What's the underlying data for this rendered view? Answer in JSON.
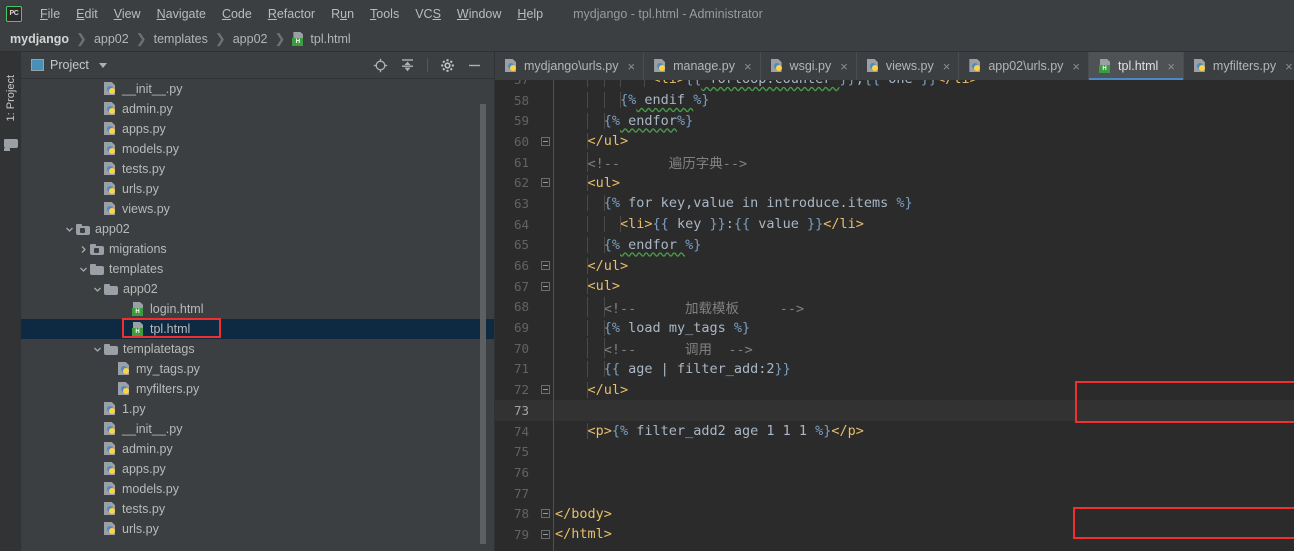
{
  "window": {
    "title": "mydjango - tpl.html - Administrator",
    "logo_text": "PC"
  },
  "menu": {
    "items": [
      {
        "label": "File",
        "mnemonic": "F"
      },
      {
        "label": "Edit",
        "mnemonic": "E"
      },
      {
        "label": "View",
        "mnemonic": "V"
      },
      {
        "label": "Navigate",
        "mnemonic": "N"
      },
      {
        "label": "Code",
        "mnemonic": "C"
      },
      {
        "label": "Refactor",
        "mnemonic": "R"
      },
      {
        "label": "Run",
        "mnemonic": "u"
      },
      {
        "label": "Tools",
        "mnemonic": "T"
      },
      {
        "label": "VCS",
        "mnemonic": "S"
      },
      {
        "label": "Window",
        "mnemonic": "W"
      },
      {
        "label": "Help",
        "mnemonic": "H"
      }
    ]
  },
  "breadcrumb": {
    "items": [
      "mydjango",
      "app02",
      "templates",
      "app02"
    ],
    "file": "tpl.html",
    "file_icon": "html-file-icon",
    "separator": "❯"
  },
  "toolstrip": {
    "tab_label": "1: Project",
    "folder_icon": "folder-icon"
  },
  "project_panel": {
    "title": "Project",
    "title_icon": "project-window-icon",
    "dropdown_icon": "chevron-down-icon",
    "actions": [
      {
        "name": "scroll-from-source-icon",
        "label": "Select Opened File"
      },
      {
        "name": "collapse-all-icon",
        "label": "Collapse All"
      },
      {
        "name": "gear-icon",
        "label": "Settings"
      },
      {
        "name": "minimize-icon",
        "label": "Hide"
      }
    ],
    "tree": [
      {
        "label": "__init__.py",
        "icon": "python-file-icon",
        "indent": 5,
        "twist": "",
        "selected": false
      },
      {
        "label": "admin.py",
        "icon": "python-file-icon",
        "indent": 5,
        "twist": "",
        "selected": false
      },
      {
        "label": "apps.py",
        "icon": "python-file-icon",
        "indent": 5,
        "twist": "",
        "selected": false
      },
      {
        "label": "models.py",
        "icon": "python-file-icon",
        "indent": 5,
        "twist": "",
        "selected": false
      },
      {
        "label": "tests.py",
        "icon": "python-file-icon",
        "indent": 5,
        "twist": "",
        "selected": false
      },
      {
        "label": "urls.py",
        "icon": "python-file-icon",
        "indent": 5,
        "twist": "",
        "selected": false
      },
      {
        "label": "views.py",
        "icon": "python-file-icon",
        "indent": 5,
        "twist": "",
        "selected": false
      },
      {
        "label": "app02",
        "icon": "source-folder-icon",
        "indent": 3,
        "twist": "down",
        "selected": false
      },
      {
        "label": "migrations",
        "icon": "source-folder-icon",
        "indent": 4,
        "twist": "right",
        "selected": false
      },
      {
        "label": "templates",
        "icon": "folder-icon",
        "indent": 4,
        "twist": "down",
        "selected": false
      },
      {
        "label": "app02",
        "icon": "folder-icon",
        "indent": 5,
        "twist": "down",
        "selected": false
      },
      {
        "label": "login.html",
        "icon": "html-file-icon",
        "indent": 7,
        "twist": "",
        "selected": false
      },
      {
        "label": "tpl.html",
        "icon": "html-file-icon",
        "indent": 7,
        "twist": "",
        "selected": true
      },
      {
        "label": "templatetags",
        "icon": "folder-icon",
        "indent": 5,
        "twist": "down",
        "selected": false
      },
      {
        "label": "my_tags.py",
        "icon": "python-file-icon",
        "indent": 6,
        "twist": "",
        "selected": false
      },
      {
        "label": "myfilters.py",
        "icon": "python-file-icon",
        "indent": 6,
        "twist": "",
        "selected": false
      },
      {
        "label": "1.py",
        "icon": "python-file-icon",
        "indent": 5,
        "twist": "",
        "selected": false
      },
      {
        "label": "__init__.py",
        "icon": "python-file-icon",
        "indent": 5,
        "twist": "",
        "selected": false
      },
      {
        "label": "admin.py",
        "icon": "python-file-icon",
        "indent": 5,
        "twist": "",
        "selected": false
      },
      {
        "label": "apps.py",
        "icon": "python-file-icon",
        "indent": 5,
        "twist": "",
        "selected": false
      },
      {
        "label": "models.py",
        "icon": "python-file-icon",
        "indent": 5,
        "twist": "",
        "selected": false
      },
      {
        "label": "tests.py",
        "icon": "python-file-icon",
        "indent": 5,
        "twist": "",
        "selected": false
      },
      {
        "label": "urls.py",
        "icon": "python-file-icon",
        "indent": 5,
        "twist": "",
        "selected": false
      }
    ]
  },
  "editor": {
    "tabs": [
      {
        "label": "mydjango\\urls.py",
        "icon": "python-file-icon",
        "active": false,
        "close": "×"
      },
      {
        "label": "manage.py",
        "icon": "python-file-icon",
        "active": false,
        "close": "×"
      },
      {
        "label": "wsgi.py",
        "icon": "python-file-icon",
        "active": false,
        "close": "×"
      },
      {
        "label": "views.py",
        "icon": "python-file-icon",
        "active": false,
        "close": "×"
      },
      {
        "label": "app02\\urls.py",
        "icon": "python-file-icon",
        "active": false,
        "close": "×"
      },
      {
        "label": "tpl.html",
        "icon": "html-file-icon",
        "active": true,
        "close": "×"
      },
      {
        "label": "myfilters.py",
        "icon": "python-file-icon",
        "active": false,
        "close": "×"
      }
    ],
    "current_line": 73,
    "lines": [
      {
        "num": 57,
        "clipped": true,
        "fold": "",
        "indent_guides": [
          4,
          6,
          8,
          11
        ],
        "tokens": [
          {
            "t": "            ",
            "c": "t-txt"
          },
          {
            "t": "<li>",
            "c": "t-tag"
          },
          {
            "t": "{{",
            "c": "t-br"
          },
          {
            "t": " forloop.counter ",
            "c": "t-kw",
            "squiggly": true
          },
          {
            "t": "}}",
            "c": "t-br"
          },
          {
            "t": ",",
            "c": "t-txt"
          },
          {
            "t": "{{",
            "c": "t-br"
          },
          {
            "t": " one ",
            "c": "t-kw"
          },
          {
            "t": "}}",
            "c": "t-br"
          },
          {
            "t": "</li>",
            "c": "t-tag"
          }
        ]
      },
      {
        "num": 58,
        "clipped": false,
        "fold": "",
        "indent_guides": [
          4,
          6,
          8
        ],
        "tokens": [
          {
            "t": "        ",
            "c": "t-txt"
          },
          {
            "t": "{%",
            "c": "t-br"
          },
          {
            "t": " endif ",
            "c": "t-kw",
            "squiggly": true
          },
          {
            "t": "%}",
            "c": "t-br"
          }
        ]
      },
      {
        "num": 59,
        "clipped": false,
        "fold": "",
        "indent_guides": [
          4,
          6
        ],
        "tokens": [
          {
            "t": "      ",
            "c": "t-txt"
          },
          {
            "t": "{%",
            "c": "t-br"
          },
          {
            "t": " endfor",
            "c": "t-kw",
            "squiggly": true
          },
          {
            "t": "%}",
            "c": "t-br"
          }
        ]
      },
      {
        "num": 60,
        "clipped": false,
        "fold": "end",
        "indent_guides": [
          4
        ],
        "tokens": [
          {
            "t": "    ",
            "c": "t-txt"
          },
          {
            "t": "</ul>",
            "c": "t-tag"
          }
        ]
      },
      {
        "num": 61,
        "clipped": false,
        "fold": "",
        "indent_guides": [
          4
        ],
        "tokens": [
          {
            "t": "    ",
            "c": "t-txt"
          },
          {
            "t": "<!--      遍历字典-->",
            "c": "t-cmt"
          }
        ]
      },
      {
        "num": 62,
        "clipped": false,
        "fold": "start",
        "indent_guides": [
          4
        ],
        "tokens": [
          {
            "t": "    ",
            "c": "t-txt"
          },
          {
            "t": "<ul>",
            "c": "t-tag"
          }
        ]
      },
      {
        "num": 63,
        "clipped": false,
        "fold": "",
        "indent_guides": [
          4,
          6
        ],
        "tokens": [
          {
            "t": "      ",
            "c": "t-txt"
          },
          {
            "t": "{%",
            "c": "t-br"
          },
          {
            "t": " for key,value in introduce.items ",
            "c": "t-kw"
          },
          {
            "t": "%}",
            "c": "t-br"
          }
        ]
      },
      {
        "num": 64,
        "clipped": false,
        "fold": "",
        "indent_guides": [
          4,
          6,
          8
        ],
        "tokens": [
          {
            "t": "        ",
            "c": "t-txt"
          },
          {
            "t": "<li>",
            "c": "t-tag"
          },
          {
            "t": "{{",
            "c": "t-br"
          },
          {
            "t": " key ",
            "c": "t-kw"
          },
          {
            "t": "}}",
            "c": "t-br"
          },
          {
            "t": ":",
            "c": "t-txt"
          },
          {
            "t": "{{",
            "c": "t-br"
          },
          {
            "t": " value ",
            "c": "t-kw"
          },
          {
            "t": "}}",
            "c": "t-br"
          },
          {
            "t": "</li>",
            "c": "t-tag"
          }
        ]
      },
      {
        "num": 65,
        "clipped": false,
        "fold": "",
        "indent_guides": [
          4,
          6
        ],
        "tokens": [
          {
            "t": "      ",
            "c": "t-txt"
          },
          {
            "t": "{%",
            "c": "t-br"
          },
          {
            "t": " endfor ",
            "c": "t-kw",
            "squiggly": true
          },
          {
            "t": "%}",
            "c": "t-br"
          }
        ]
      },
      {
        "num": 66,
        "clipped": false,
        "fold": "end",
        "indent_guides": [
          4
        ],
        "tokens": [
          {
            "t": "    ",
            "c": "t-txt"
          },
          {
            "t": "</ul>",
            "c": "t-tag"
          }
        ]
      },
      {
        "num": 67,
        "clipped": false,
        "fold": "start",
        "indent_guides": [
          4
        ],
        "tokens": [
          {
            "t": "    ",
            "c": "t-txt"
          },
          {
            "t": "<ul>",
            "c": "t-tag"
          }
        ]
      },
      {
        "num": 68,
        "clipped": false,
        "fold": "",
        "indent_guides": [
          4,
          6
        ],
        "tokens": [
          {
            "t": "      ",
            "c": "t-txt"
          },
          {
            "t": "<!--      加载模板     -->",
            "c": "t-cmt"
          }
        ]
      },
      {
        "num": 69,
        "clipped": false,
        "fold": "",
        "indent_guides": [
          4,
          6
        ],
        "tokens": [
          {
            "t": "      ",
            "c": "t-txt"
          },
          {
            "t": "{%",
            "c": "t-br"
          },
          {
            "t": " load my_tags ",
            "c": "t-kw"
          },
          {
            "t": "%}",
            "c": "t-br"
          }
        ]
      },
      {
        "num": 70,
        "clipped": false,
        "fold": "",
        "indent_guides": [
          4,
          6
        ],
        "tokens": [
          {
            "t": "      ",
            "c": "t-txt"
          },
          {
            "t": "<!--      调用  -->",
            "c": "t-cmt"
          }
        ]
      },
      {
        "num": 71,
        "clipped": false,
        "fold": "",
        "indent_guides": [
          4,
          6
        ],
        "tokens": [
          {
            "t": "      ",
            "c": "t-txt"
          },
          {
            "t": "{{",
            "c": "t-br"
          },
          {
            "t": " age | filter_add:2",
            "c": "t-kw"
          },
          {
            "t": "}}",
            "c": "t-br"
          }
        ]
      },
      {
        "num": 72,
        "clipped": false,
        "fold": "end",
        "indent_guides": [
          4
        ],
        "tokens": [
          {
            "t": "    ",
            "c": "t-txt"
          },
          {
            "t": "</ul>",
            "c": "t-tag"
          }
        ]
      },
      {
        "num": 73,
        "clipped": false,
        "fold": "",
        "indent_guides": [],
        "tokens": [
          {
            "t": "",
            "c": "t-txt"
          }
        ]
      },
      {
        "num": 74,
        "clipped": false,
        "fold": "",
        "indent_guides": [
          4
        ],
        "tokens": [
          {
            "t": "    ",
            "c": "t-txt"
          },
          {
            "t": "<p>",
            "c": "t-tag"
          },
          {
            "t": "{%",
            "c": "t-br"
          },
          {
            "t": " filter_add2 age 1 1 1 ",
            "c": "t-kw"
          },
          {
            "t": "%}",
            "c": "t-br"
          },
          {
            "t": "</p>",
            "c": "t-tag"
          }
        ]
      },
      {
        "num": 75,
        "clipped": false,
        "fold": "",
        "indent_guides": [],
        "tokens": [
          {
            "t": "",
            "c": "t-txt"
          }
        ]
      },
      {
        "num": 76,
        "clipped": false,
        "fold": "",
        "indent_guides": [],
        "tokens": [
          {
            "t": "",
            "c": "t-txt"
          }
        ]
      },
      {
        "num": 77,
        "clipped": false,
        "fold": "",
        "indent_guides": [],
        "tokens": [
          {
            "t": "",
            "c": "t-txt"
          }
        ]
      },
      {
        "num": 78,
        "clipped": false,
        "fold": "end",
        "indent_guides": [],
        "tokens": [
          {
            "t": "",
            "c": "t-txt"
          },
          {
            "t": "</body>",
            "c": "t-tag"
          }
        ]
      },
      {
        "num": 79,
        "clipped": true,
        "fold": "end",
        "indent_guides": [],
        "tokens": [
          {
            "t": "",
            "c": "t-txt"
          },
          {
            "t": "</html>",
            "c": "t-tag"
          }
        ]
      }
    ]
  },
  "annotations": [
    {
      "name": "annotation-box-tree-tpl",
      "color": "#f03030",
      "target": "tpl.html tree row"
    },
    {
      "name": "annotation-box-load-tag",
      "color": "#f03030",
      "target": "lines 68-69 load my_tags"
    },
    {
      "name": "annotation-box-filter-add2",
      "color": "#f03030",
      "target": "line 74 filter_add2"
    }
  ],
  "colors": {
    "bg_chrome": "#3c3f41",
    "bg_editor": "#2b2b2b",
    "selection": "#0d2a42",
    "accent": "#4a88c7",
    "annotation": "#f03030",
    "tag": "#e8bf6a",
    "brace": "#7a9ec2",
    "comment": "#808080"
  }
}
